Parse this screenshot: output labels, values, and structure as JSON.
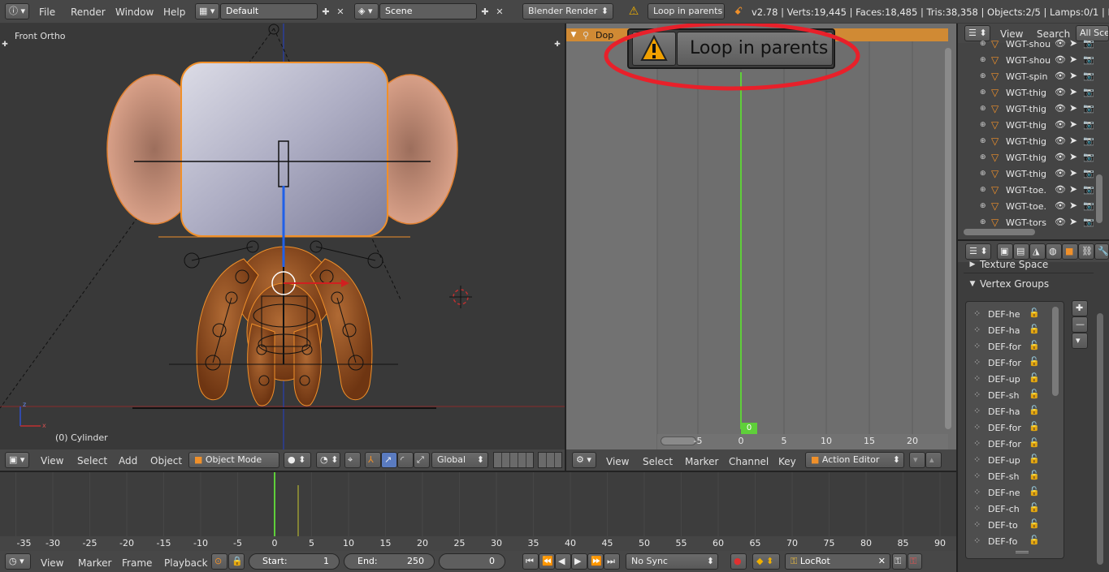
{
  "topbar": {
    "menus": [
      "File",
      "Render",
      "Window",
      "Help"
    ],
    "screen_layout": "Default",
    "scene": "Scene",
    "engine": "Blender Render",
    "warning_message": "Loop in parents",
    "stats": "v2.78 | Verts:19,445 | Faces:18,485 | Tris:38,358 | Objects:2/5 | Lamps:0/1 | Mem:43."
  },
  "viewport": {
    "view_label": "Front Ortho",
    "object_label": "(0) Cylinder",
    "menus": [
      "View",
      "Select",
      "Add",
      "Object"
    ],
    "mode": "Object Mode",
    "orientation": "Global"
  },
  "dopesheet": {
    "channel_label": "Dop",
    "popup_text": "Loop in parents",
    "current_frame": "0",
    "ruler": [
      "-5",
      "0",
      "5",
      "10",
      "15",
      "20"
    ],
    "menus": [
      "View",
      "Select",
      "Marker",
      "Channel",
      "Key"
    ],
    "editor_mode": "Action Editor"
  },
  "outliner": {
    "menus": [
      "View",
      "Search"
    ],
    "filter": "All Sce",
    "items": [
      "WGT-shou",
      "WGT-shou",
      "WGT-spin",
      "WGT-thig",
      "WGT-thig",
      "WGT-thig",
      "WGT-thig",
      "WGT-thig",
      "WGT-thig",
      "WGT-toe.",
      "WGT-toe.",
      "WGT-tors"
    ]
  },
  "properties": {
    "texture_space_label": "Texture Space",
    "vertex_groups_label": "Vertex Groups",
    "vertex_groups": [
      "DEF-he",
      "DEF-ha",
      "DEF-for",
      "DEF-for",
      "DEF-up",
      "DEF-sh",
      "DEF-ha",
      "DEF-for",
      "DEF-for",
      "DEF-up",
      "DEF-sh",
      "DEF-ne",
      "DEF-ch",
      "DEF-to",
      "DEF-fo"
    ]
  },
  "timeline": {
    "ruler": [
      "-35",
      "-30",
      "-25",
      "-20",
      "-15",
      "-10",
      "-5",
      "0",
      "5",
      "10",
      "15",
      "20",
      "25",
      "30",
      "35",
      "40",
      "45",
      "50",
      "55",
      "60",
      "65",
      "70",
      "75",
      "80",
      "85",
      "90"
    ],
    "menus": [
      "View",
      "Marker",
      "Frame",
      "Playback"
    ],
    "start_label": "Start:",
    "start_value": "1",
    "end_label": "End:",
    "end_value": "250",
    "current_frame": "0",
    "sync": "No Sync",
    "keying_set": "LocRot"
  },
  "colors": {
    "accent_orange": "#f0902a",
    "frame_green": "#5fcf3a",
    "annotation_red": "#e8202a"
  }
}
